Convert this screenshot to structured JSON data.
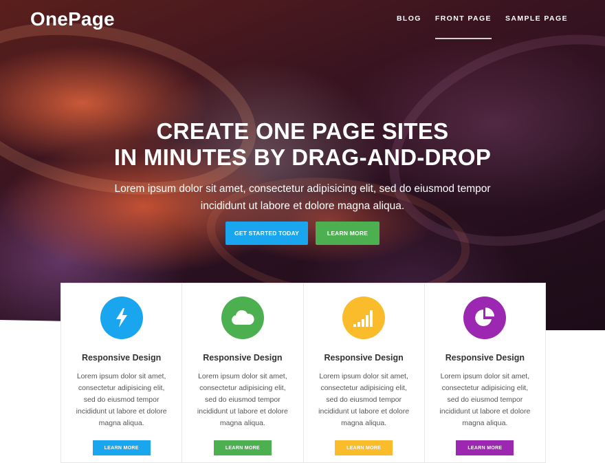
{
  "brand": {
    "name": "OnePage"
  },
  "nav": {
    "items": [
      {
        "label": "BLOG"
      },
      {
        "label": "FRONT PAGE"
      },
      {
        "label": "SAMPLE PAGE"
      }
    ]
  },
  "hero": {
    "headline_line1": "CREATE ONE PAGE SITES",
    "headline_line2": "IN MINUTES BY DRAG-AND-DROP",
    "subline_line1": "Lorem ipsum dolor sit amet, consectetur adipisicing elit, sed do eiusmod tempor",
    "subline_line2": "incididunt ut labore et dolore magna aliqua.",
    "primary_button": "GET STARTED TODAY",
    "secondary_button": "LEARN MORE"
  },
  "colors": {
    "blue": "#1aa6ee",
    "green": "#4caf50",
    "yellow": "#fbbc2c",
    "purple": "#9c27b0"
  },
  "features": [
    {
      "icon": "lightning-icon",
      "title": "Responsive Design",
      "text_lines": [
        "Lorem ipsum dolor sit amet,",
        "consectetur adipisicing elit,",
        "sed do eiusmod tempor",
        "incididunt ut labore et dolore",
        "magna aliqua."
      ],
      "button": "LEARN MORE"
    },
    {
      "icon": "cloud-icon",
      "title": "Responsive Design",
      "text_lines": [
        "Lorem ipsum dolor sit amet,",
        "consectetur adipisicing elit,",
        "sed do eiusmod tempor",
        "incididunt ut labore et dolore",
        "magna aliqua."
      ],
      "button": "LEARN MORE"
    },
    {
      "icon": "signal-bars-icon",
      "title": "Responsive Design",
      "text_lines": [
        "Lorem ipsum dolor sit amet,",
        "consectetur adipisicing elit,",
        "sed do eiusmod tempor",
        "incididunt ut labore et dolore",
        "magna aliqua."
      ],
      "button": "LEARN MORE"
    },
    {
      "icon": "pie-chart-icon",
      "title": "Responsive Design",
      "text_lines": [
        "Lorem ipsum dolor sit amet,",
        "consectetur adipisicing elit,",
        "sed do eiusmod tempor",
        "incididunt ut labore et dolore",
        "magna aliqua."
      ],
      "button": "LEARN MORE"
    }
  ]
}
